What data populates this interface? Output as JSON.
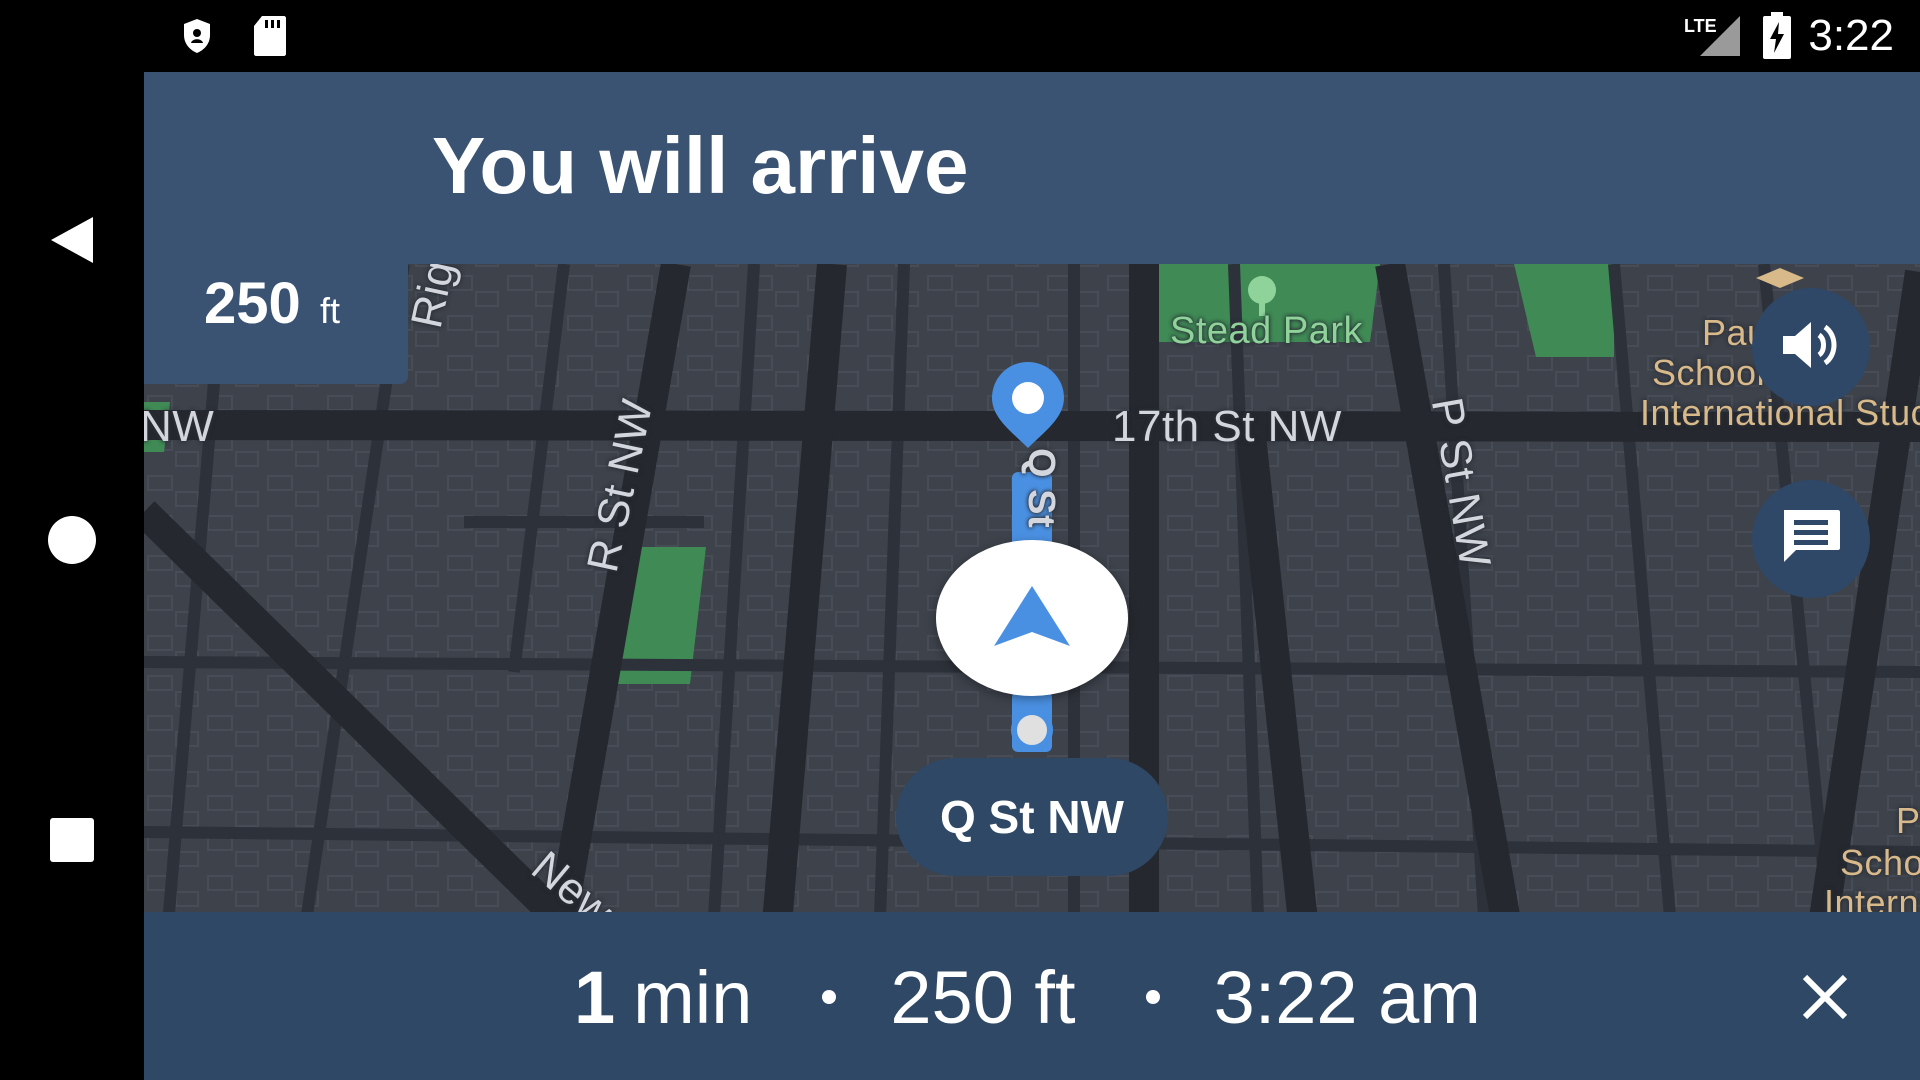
{
  "status_bar": {
    "time": "3:22",
    "network_label": "LTE",
    "icons": [
      "shield-icon",
      "sd-card-icon",
      "lte-signal-icon",
      "battery-charging-icon"
    ]
  },
  "nav_bar": {
    "buttons": [
      "back-icon",
      "home-icon",
      "recents-icon"
    ]
  },
  "banner": {
    "title": "You will arrive",
    "distance_value": "250",
    "distance_unit": "ft"
  },
  "map": {
    "streets": {
      "riggs": "Riggs P",
      "nw_left": "NW",
      "r_st": "R St NW",
      "seventeenth": "17th St NW",
      "p_st": "P St NW",
      "q_st_vertical": "Q St",
      "new": "New"
    },
    "places": {
      "park": "Stead Park",
      "school_line1": "Pau         tze",
      "school_line2": "School        anc",
      "school_line3": "International Stuc",
      "school2_line1": "P",
      "school2_line2": "Scho",
      "school2_line3": "Intern"
    },
    "current_street": "Q St NW",
    "accent_color": "#4a90e2",
    "park_color": "#3f8a55"
  },
  "fabs": {
    "sound": "volume-icon",
    "messages": "message-icon"
  },
  "trip": {
    "minutes_value": "1",
    "minutes_unit": "min",
    "distance": "250 ft",
    "arrival": "3:22 am"
  }
}
